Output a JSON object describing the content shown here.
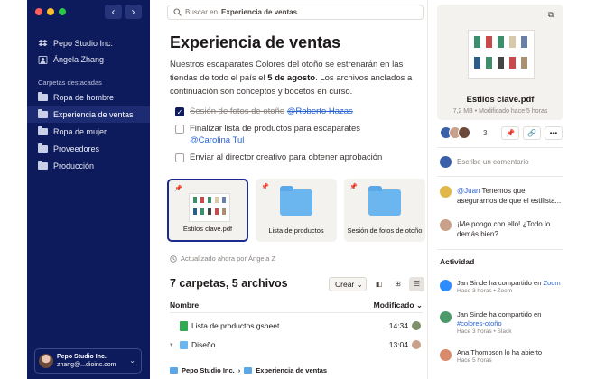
{
  "sidebar": {
    "team": "Pepo Studio Inc.",
    "user": "Ángela Zhang",
    "section_title": "Carpetas destacadas",
    "items": [
      {
        "label": "Ropa de hombre"
      },
      {
        "label": "Experiencia de ventas"
      },
      {
        "label": "Ropa de mujer"
      },
      {
        "label": "Proveedores"
      },
      {
        "label": "Producción"
      }
    ],
    "account": {
      "name": "Pepo Studio Inc.",
      "email": "zhang@...dioinc.com"
    }
  },
  "search": {
    "prefix": "Buscar en",
    "scope": "Experiencia de ventas"
  },
  "page": {
    "title": "Experiencia de ventas",
    "desc_1": "Nuestros escaparates Colores del otoño se estrenarán en las tiendas de todo el país el ",
    "desc_bold": "5 de agosto",
    "desc_2": ". Los archivos anclados a continuación son conceptos y bocetos en curso."
  },
  "tasks": [
    {
      "text": "Sesión de fotos de otoño",
      "mention": "@Roberto Hazas",
      "checked": true
    },
    {
      "text": "Finalizar lista de productos para escaparates",
      "mention": "@Carolina Tul",
      "checked": false
    },
    {
      "text": "Enviar al director creativo para obtener aprobación",
      "mention": "",
      "checked": false
    }
  ],
  "pinned": [
    {
      "label": "Estilos clave.pdf"
    },
    {
      "label": "Lista de productos"
    },
    {
      "label": "Sesión de fotos de otoño"
    }
  ],
  "updated_text": "Actualizado ahora por Ángela Z",
  "listing": {
    "counts": "7 carpetas, 5 archivos",
    "create_label": "Crear",
    "col_name": "Nombre",
    "col_modified": "Modificado",
    "rows": [
      {
        "name": "Lista de productos.gsheet",
        "time": "14:34"
      },
      {
        "name": "Diseño",
        "time": "13:04"
      }
    ]
  },
  "breadcrumb": {
    "root": "Pepo Studio Inc.",
    "current": "Experiencia de ventas"
  },
  "preview": {
    "name": "Estilos clave.pdf",
    "meta": "7,2 MB • Modificado hace 5 horas",
    "share_count": "3"
  },
  "comments": {
    "placeholder": "Escribe un comentario",
    "items": [
      {
        "mention": "@Juan",
        "text": " Tenemos que asegurarnos de que el estilista..."
      },
      {
        "mention": "",
        "text": "¡Me pongo con ello! ¿Todo lo demás bien?"
      }
    ]
  },
  "activity": {
    "title": "Actividad",
    "items": [
      {
        "text": "Jan Sinde ha compartido en ",
        "link": "Zoom",
        "sub": "Hace 3 horas • Zoom"
      },
      {
        "text": "Jan Sinde ha compartido en ",
        "link": "#colores-otoño",
        "sub": "Hace 3 horas • Slack"
      },
      {
        "text": "Ana Thompson lo ha abierto",
        "link": "",
        "sub": "Hace 5 horas"
      }
    ]
  },
  "colors": {
    "sidebar": "#0d1b5c",
    "accent": "#2a64d4",
    "folder": "#6cb6f0"
  }
}
